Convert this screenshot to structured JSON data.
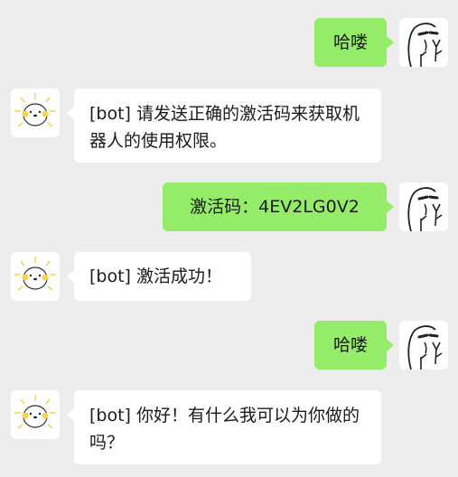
{
  "messages": [
    {
      "side": "out",
      "text": "哈喽"
    },
    {
      "side": "in",
      "text": "[bot] 请发送正确的激活码来获取机器人的使用权限。"
    },
    {
      "side": "out",
      "text": "激活码：4EV2LG0V2"
    },
    {
      "side": "in",
      "text": "[bot] 激活成功！"
    },
    {
      "side": "out",
      "text": "哈喽"
    },
    {
      "side": "in",
      "text": "[bot] 你好！有什么我可以为你做的吗？"
    }
  ],
  "colors": {
    "background": "#ededed",
    "outgoing_bubble": "#95ec69",
    "incoming_bubble": "#ffffff"
  },
  "avatars": {
    "user": "doodle-face-peace-sign-icon",
    "bot": "sparkling-hamster-icon"
  }
}
